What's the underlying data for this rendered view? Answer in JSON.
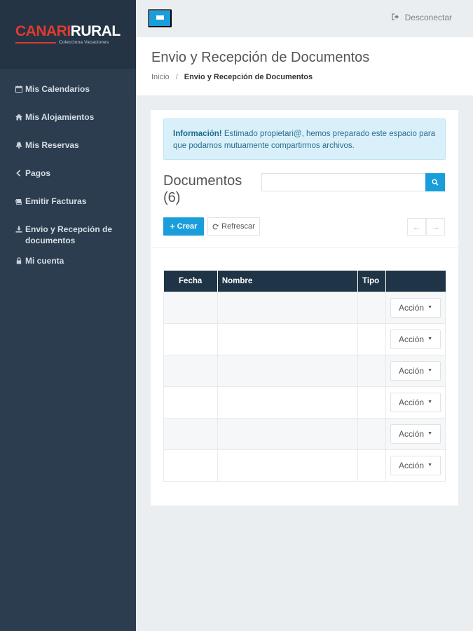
{
  "brand": {
    "logo_part1": "CANARI",
    "logo_part2": "RURAL",
    "tagline": "Colecciona Vacaciones"
  },
  "sidebar": {
    "items": [
      {
        "label": "Mis Calendarios",
        "icon": "calendar-icon"
      },
      {
        "label": "Mis Alojamientos",
        "icon": "home-icon"
      },
      {
        "label": "Mis Reservas",
        "icon": "bell-icon"
      },
      {
        "label": "Pagos",
        "icon": "chevron-left-icon"
      },
      {
        "label": "Emitir Facturas",
        "icon": "invoice-icon"
      },
      {
        "label": "Envio y Recepción de documentos",
        "icon": "download-icon"
      },
      {
        "label": "Mi cuenta",
        "icon": "lock-icon"
      }
    ]
  },
  "topbar": {
    "logout_label": "Desconectar"
  },
  "page": {
    "title": "Envio y Recepción de Documentos",
    "breadcrumb": {
      "home": "Inicio",
      "separator": "/",
      "current": "Envio y Recepción de Documentos"
    }
  },
  "alert": {
    "strong": "Información!",
    "text": " Estimado propietari@, hemos preparado este espacio para que podamos mutuamente compartirmos archivos."
  },
  "documents": {
    "title": "Documentos",
    "count": "(6)",
    "search_placeholder": "",
    "create_label": "Crear",
    "refresh_label": "Refrescar",
    "columns": [
      "Fecha",
      "Nombre",
      "Tipo",
      ""
    ],
    "rows": [
      {
        "fecha": "",
        "nombre": "",
        "tipo": "",
        "action": "Acción"
      },
      {
        "fecha": "",
        "nombre": "",
        "tipo": "",
        "action": "Acción"
      },
      {
        "fecha": "",
        "nombre": "",
        "tipo": "",
        "action": "Acción"
      },
      {
        "fecha": "",
        "nombre": "",
        "tipo": "",
        "action": "Acción"
      },
      {
        "fecha": "",
        "nombre": "",
        "tipo": "",
        "action": "Acción"
      },
      {
        "fecha": "",
        "nombre": "",
        "tipo": "",
        "action": "Acción"
      }
    ]
  },
  "colors": {
    "sidebar_bg": "#2b3d4f",
    "accent": "#1a9ddb",
    "table_header": "#1f3446",
    "brand_red": "#e23a2f"
  }
}
